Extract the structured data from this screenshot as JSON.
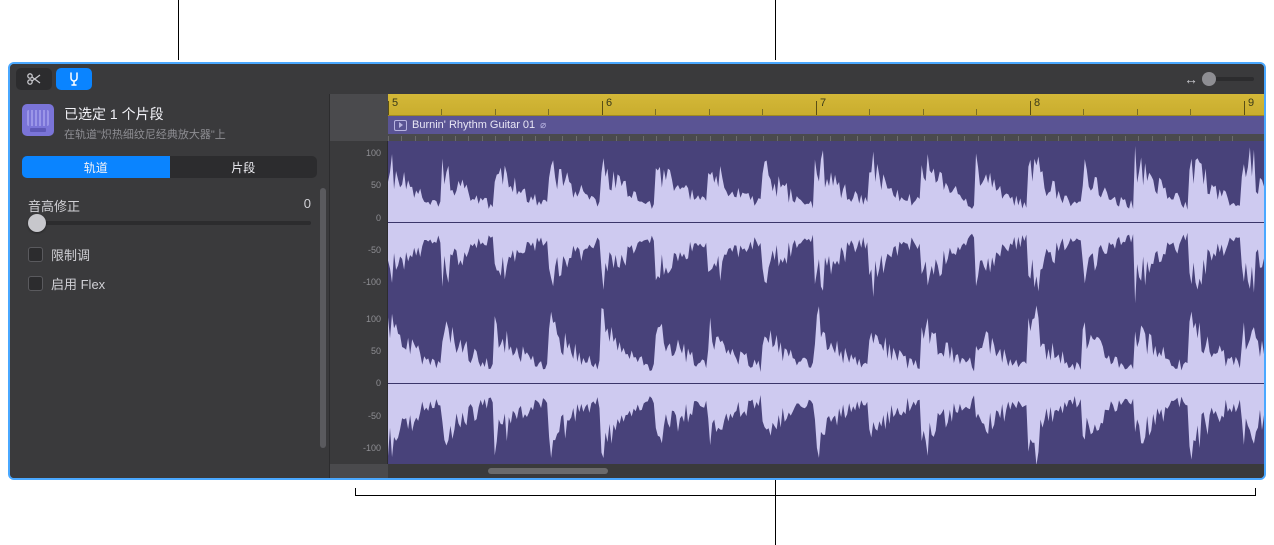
{
  "inspector": {
    "title": "已选定 1 个片段",
    "subtitle": "在轨道\"炽热细纹尼经典放大器\"上",
    "tabs": {
      "track": "轨道",
      "region": "片段"
    },
    "pitch_label": "音高修正",
    "pitch_value": "0",
    "limit_key_label": "限制调",
    "enable_flex_label": "启用 Flex"
  },
  "region": {
    "name": "Burnin' Rhythm Guitar 01"
  },
  "ruler": {
    "marks": [
      "5",
      "6",
      "7",
      "8",
      "9"
    ]
  },
  "y_axis": {
    "labels": [
      "100",
      "50",
      "0",
      "-50",
      "-100",
      "100",
      "50",
      "0",
      "-50",
      "-100"
    ]
  },
  "icons": {
    "scissors": "scissors-icon",
    "tuning": "tuning-fork-icon",
    "zoom": "horizontal-zoom-icon"
  }
}
